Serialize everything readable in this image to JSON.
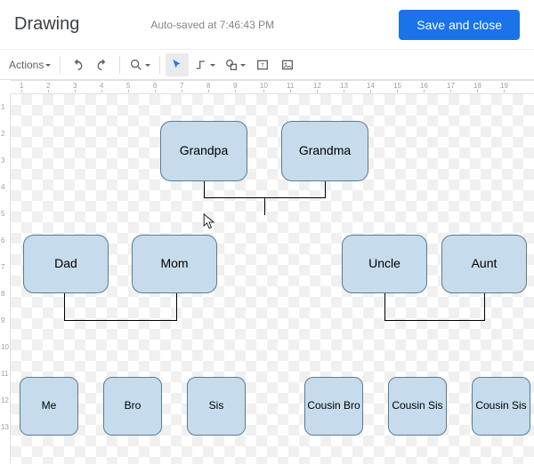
{
  "header": {
    "title": "Drawing",
    "autosave": "Auto-saved at 7:46:43 PM",
    "save_button": "Save and close"
  },
  "toolbar": {
    "actions": "Actions"
  },
  "ruler_h": [
    "1",
    "2",
    "3",
    "4",
    "5",
    "6",
    "7",
    "8",
    "9",
    "10",
    "11",
    "12",
    "13",
    "14",
    "15",
    "16",
    "17",
    "18",
    "19"
  ],
  "ruler_v": [
    "1",
    "2",
    "3",
    "4",
    "5",
    "6",
    "7",
    "8",
    "9",
    "10",
    "11",
    "12",
    "13"
  ],
  "shapes": {
    "grandpa": "Grandpa",
    "grandma": "Grandma",
    "dad": "Dad",
    "mom": "Mom",
    "uncle": "Uncle",
    "aunt": "Aunt",
    "me": "Me",
    "bro": "Bro",
    "sis": "Sis",
    "cousin_bro": "Cousin Bro",
    "cousin_sis1": "Cousin Sis",
    "cousin_sis2": "Cousin Sis"
  }
}
